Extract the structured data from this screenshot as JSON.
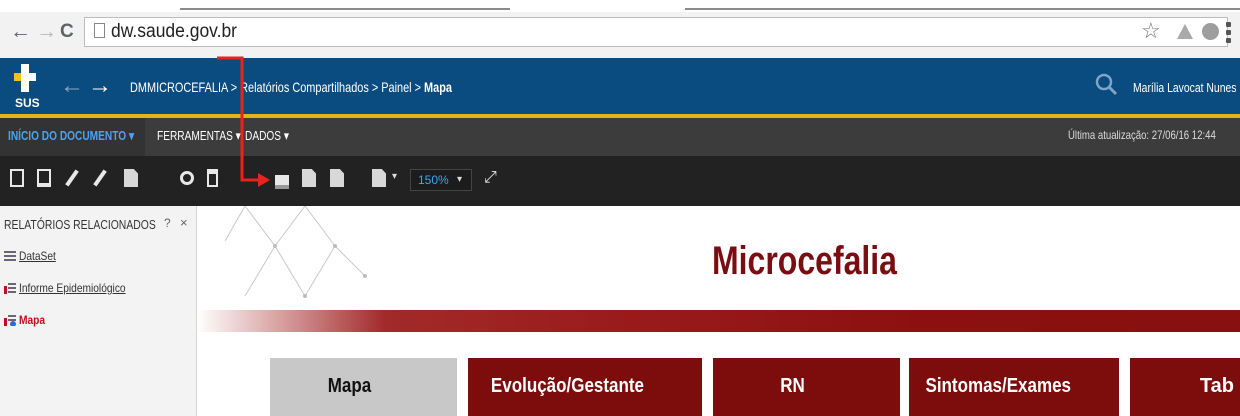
{
  "browser": {
    "url": "dw.saude.gov.br"
  },
  "app": {
    "logo_text": "SUS",
    "breadcrumb": {
      "path": "DMMICROCEFALIA > Relatórios Compartilhados > Painel > ",
      "current": "Mapa"
    },
    "user_name": "Marília Lavocat Nunes"
  },
  "menubar": {
    "items": [
      {
        "label": "INÍCIO DO DOCUMENTO",
        "color": "#4aa3f0"
      },
      {
        "label": "FERRAMENTAS",
        "color": "#ffffff"
      },
      {
        "label": "DADOS",
        "color": "#ffffff"
      }
    ],
    "updated": "Última atualização: 27/06/16 12:44"
  },
  "toolbar": {
    "zoom": "150%",
    "tools": [
      "save-icon",
      "present-icon",
      "edit-icon",
      "edit-alt-icon",
      "document-icon",
      "settings-doc-icon",
      "bookmark-icon",
      "print-icon",
      "printer-icon",
      "export-icon",
      "settings-export-icon",
      "layout-icon",
      "expand-icon"
    ]
  },
  "left_panel": {
    "title": "RELATÓRIOS RELACIONADOS",
    "help": "?",
    "close": "×",
    "items": [
      {
        "label": "DataSet",
        "selected": false
      },
      {
        "label": "Informe Epidemiológico",
        "selected": false
      },
      {
        "label": "Mapa",
        "selected": true
      }
    ]
  },
  "report": {
    "title": "Microcefalia",
    "tabs": [
      {
        "label": "Mapa",
        "active": true
      },
      {
        "label": "Evolução/Gestante",
        "active": false
      },
      {
        "label": "RN",
        "active": false
      },
      {
        "label": "Sintomas/Exames",
        "active": false
      },
      {
        "label": "Tab",
        "active": false
      }
    ]
  },
  "colors": {
    "header": "#0a4b80",
    "header_border": "#e8b414",
    "brand_red": "#7a0d12",
    "annotation": "#e8231c"
  }
}
